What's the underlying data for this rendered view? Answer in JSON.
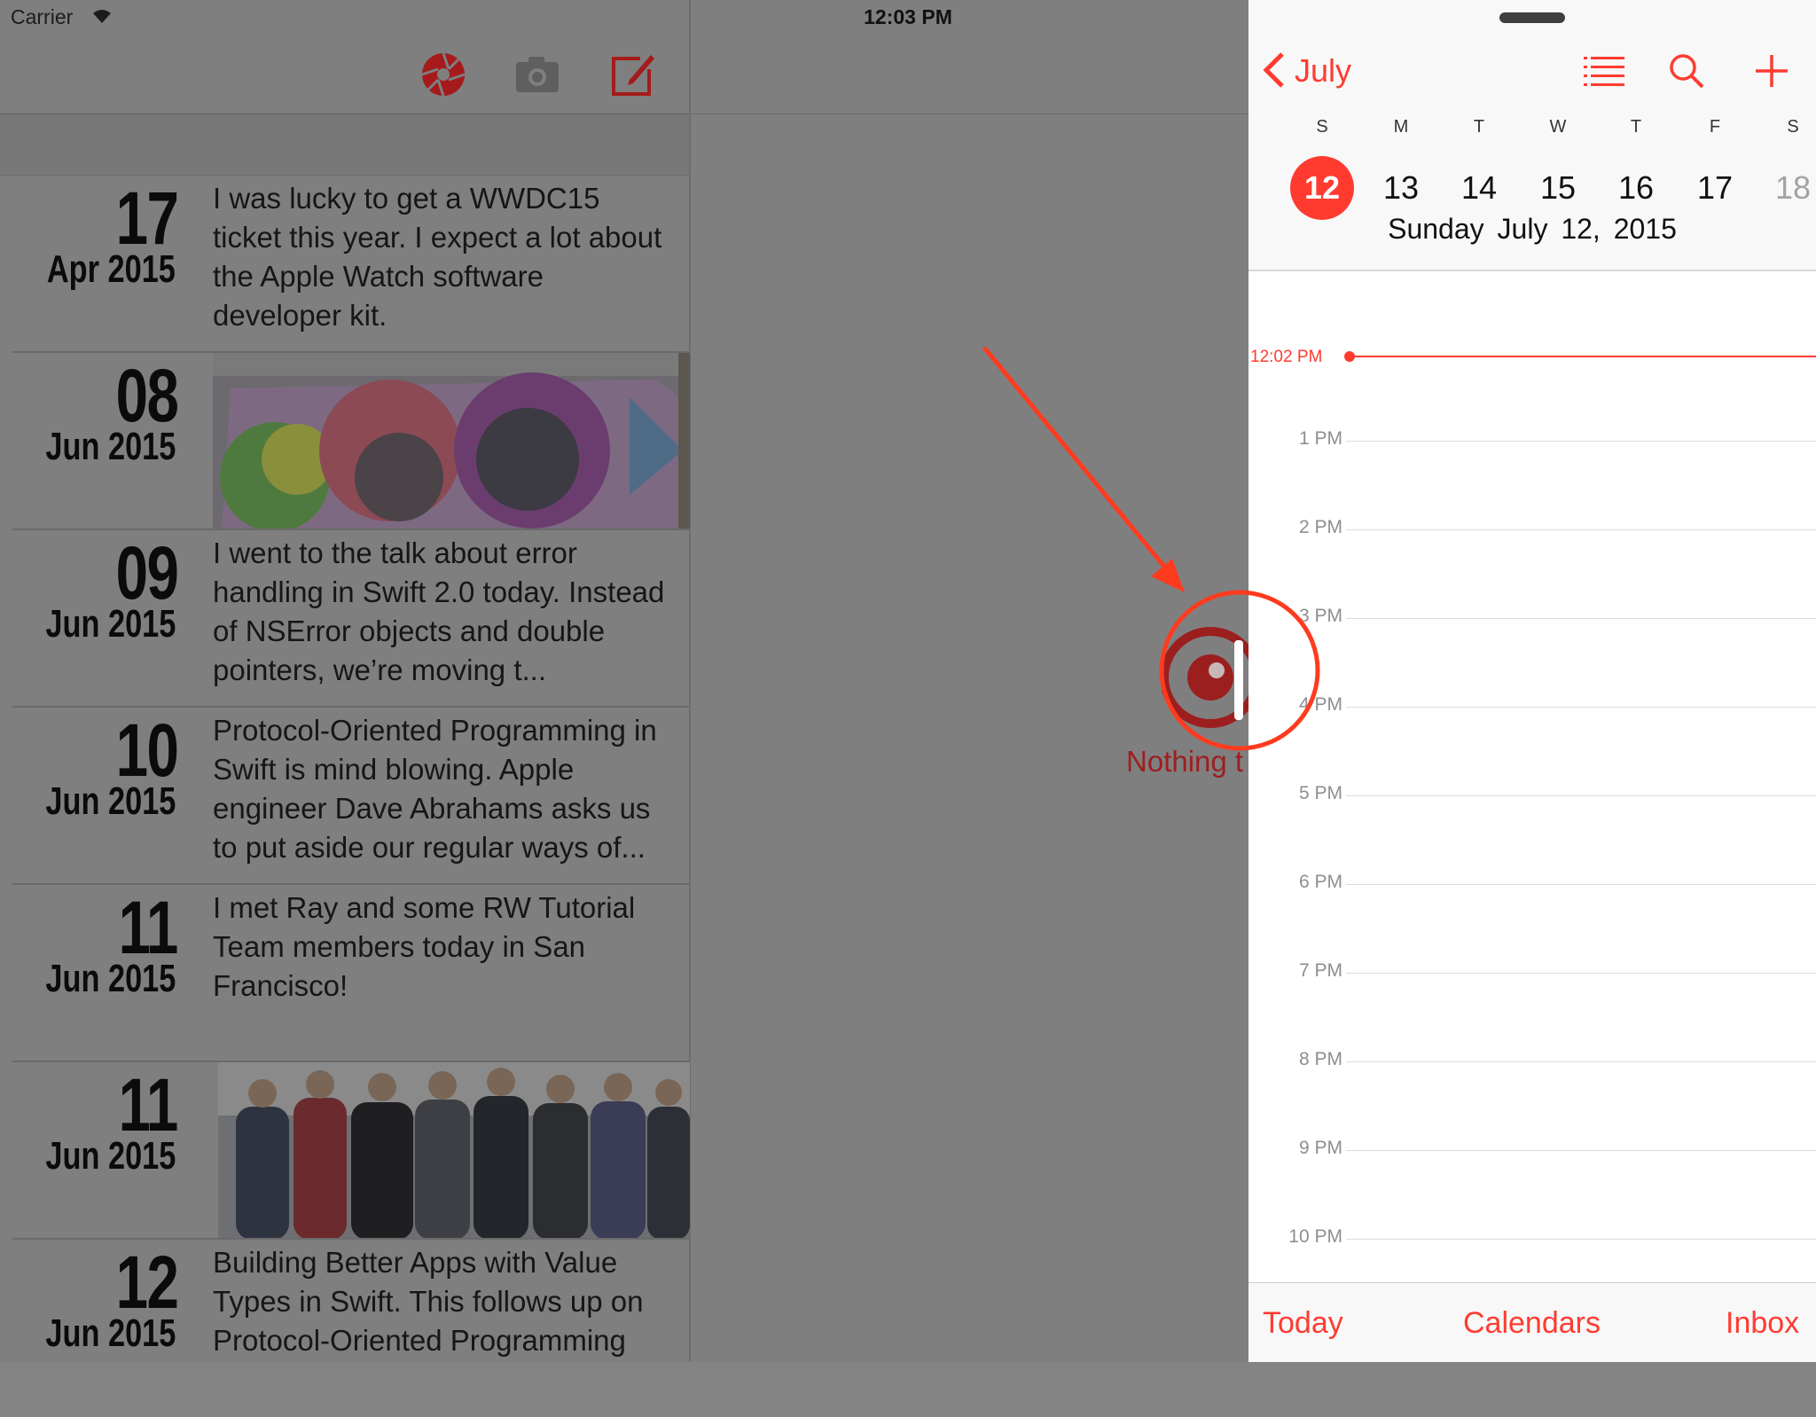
{
  "status_bar": {
    "carrier": "Carrier",
    "time": "12:03 PM"
  },
  "journal": {
    "entries": [
      {
        "day": "17",
        "month": "Apr 2015",
        "text": "I was lucky to get a WWDC15 ticket this year. I expect a lot about the Apple Watch software developer kit."
      },
      {
        "day": "08",
        "month": "Jun 2015",
        "photo": "wwdc-banner-photo"
      },
      {
        "day": "09",
        "month": "Jun 2015",
        "text": "I went to the talk about error handling in Swift 2.0 today. Instead of NSError objects and double pointers, we’re moving t..."
      },
      {
        "day": "10",
        "month": "Jun 2015",
        "text": "Protocol-Oriented Programming in Swift is mind blowing. Apple engineer Dave Abrahams asks us to put aside our regular ways of..."
      },
      {
        "day": "11",
        "month": "Jun 2015",
        "text": "I met Ray and some RW Tutorial Team members today in San Francisco!"
      },
      {
        "day": "11",
        "month": "Jun 2015",
        "photo": "group-photo"
      },
      {
        "day": "12",
        "month": "Jun 2015",
        "text": "Building Better Apps with Value Types in Swift. This follows up on Protocol-Oriented Programming"
      }
    ],
    "empty_detail": "Nothing t",
    "toolbar_icons": [
      "shutter-icon",
      "camera-icon",
      "compose-icon"
    ]
  },
  "calendar": {
    "month_back": "July",
    "weekdays": [
      "S",
      "M",
      "T",
      "W",
      "T",
      "F",
      "S"
    ],
    "days": [
      "12",
      "13",
      "14",
      "15",
      "16",
      "17",
      "18"
    ],
    "selected_date": "Sunday  July 12, 2015",
    "current_time": "12:02 PM",
    "hours": [
      "1 PM",
      "2 PM",
      "3 PM",
      "4 PM",
      "5 PM",
      "6 PM",
      "7 PM",
      "8 PM",
      "9 PM",
      "10 PM"
    ],
    "footer": {
      "today": "Today",
      "calendars": "Calendars",
      "inbox": "Inbox"
    },
    "accent": "#ff3b30"
  },
  "annotation": {
    "color": "#ff3b1f"
  }
}
